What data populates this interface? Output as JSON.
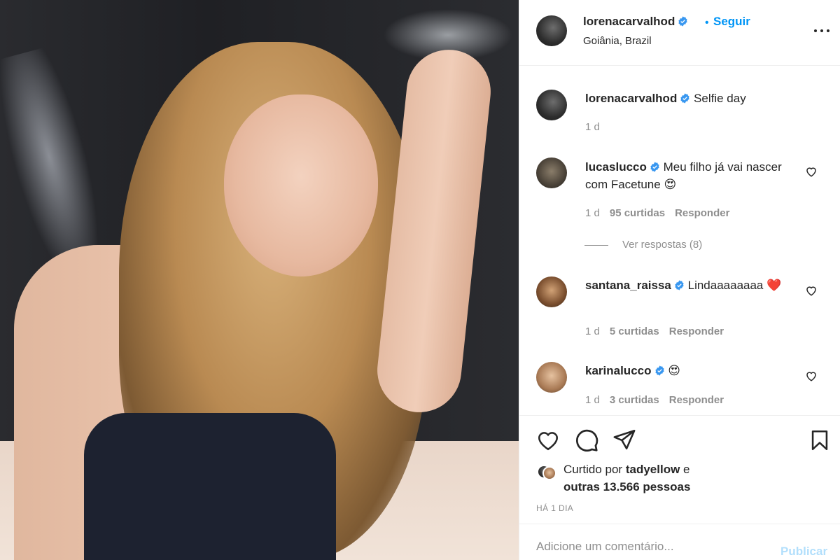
{
  "post": {
    "author": "lorenacarvalhod",
    "follow_label": "Seguir",
    "location": "Goiânia, Brazil",
    "caption": "Selfie day",
    "caption_time": "1 d"
  },
  "comments": [
    {
      "user": "lucaslucco",
      "text": "Meu filho já vai nascer com Facetune 😍",
      "time": "1 d",
      "likes": "95 curtidas",
      "reply": "Responder",
      "view_replies": "Ver respostas (8)"
    },
    {
      "user": "santana_raissa",
      "text": "Lindaaaaaaaa ❤️",
      "time": "1 d",
      "likes": "5 curtidas",
      "reply": "Responder"
    },
    {
      "user": "karinalucco",
      "text": "😍",
      "time": "1 d",
      "likes": "3 curtidas",
      "reply": "Responder"
    }
  ],
  "likes": {
    "prefix": "Curtido por",
    "user": "tadyellow",
    "conj": "e",
    "others": "outras 13.566 pessoas"
  },
  "timestamp": "HÁ 1 DIA",
  "comment_box": {
    "placeholder": "Adicione um comentário...",
    "publish_label": "Publicar"
  },
  "icons": {
    "like": "heart-icon",
    "comment": "comment-icon",
    "share": "paper-plane-icon",
    "save": "bookmark-icon",
    "more": "more-options-icon",
    "verified": "verified-badge-icon"
  },
  "colors": {
    "link_blue": "#0095f6",
    "verified_blue": "#3897f0",
    "muted": "#8e8e8e",
    "publish_disabled": "#b2dffc"
  }
}
